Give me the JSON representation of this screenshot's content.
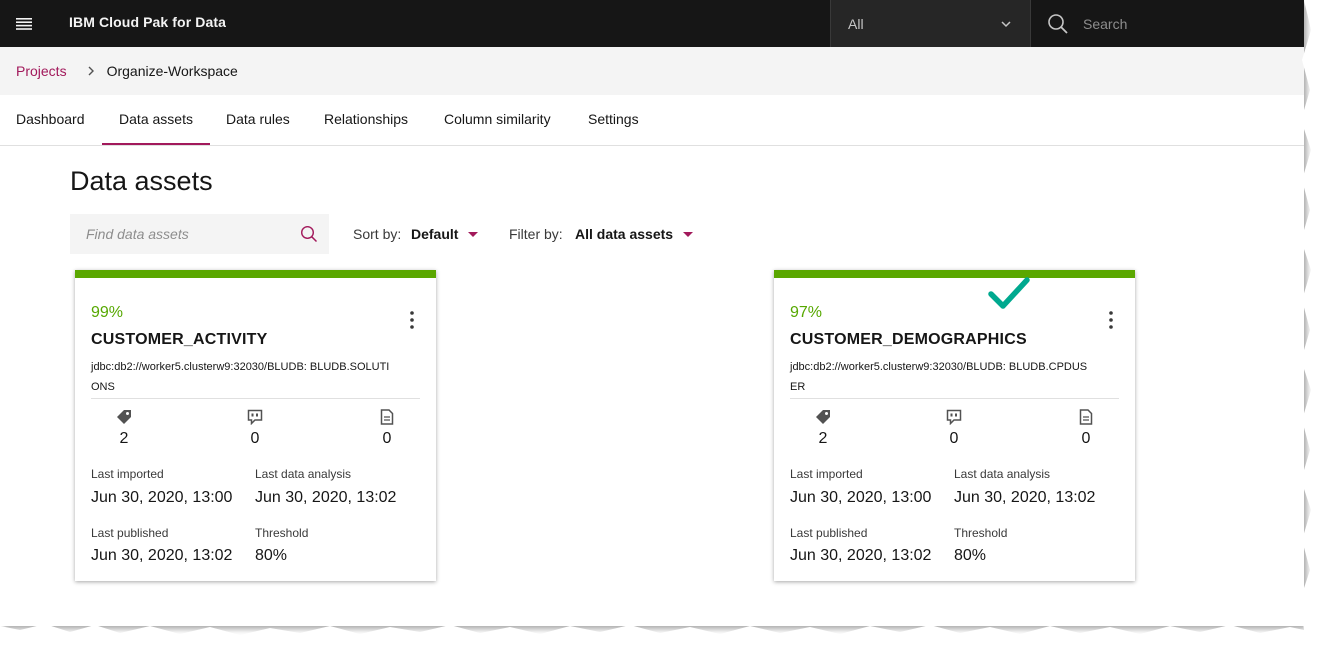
{
  "header": {
    "menu_icon": "hamburger-menu-icon",
    "brand": "IBM Cloud Pak for Data",
    "scope": {
      "selected": "All"
    },
    "search": {
      "placeholder": "Search"
    }
  },
  "breadcrumb": {
    "parent": "Projects",
    "current": "Organize-Workspace"
  },
  "tabs": [
    {
      "label": "Dashboard",
      "active": false
    },
    {
      "label": "Data assets",
      "active": true
    },
    {
      "label": "Data rules",
      "active": false
    },
    {
      "label": "Relationships",
      "active": false
    },
    {
      "label": "Column similarity",
      "active": false
    },
    {
      "label": "Settings",
      "active": false
    }
  ],
  "main": {
    "title": "Data assets",
    "find": {
      "placeholder": "Find data assets"
    },
    "sort": {
      "label": "Sort by:",
      "value": "Default"
    },
    "filter": {
      "label": "Filter by:",
      "value": "All data assets"
    }
  },
  "cards": [
    {
      "quality": "99%",
      "name": "CUSTOMER_ACTIVITY",
      "connection": "jdbc:db2://worker5.clusterw9:32030/BLUDB: BLUDB.SOLUTIONS",
      "stats": {
        "terms": "2",
        "comments": "0",
        "documents": "0"
      },
      "last_imported_label": "Last imported",
      "last_imported": "Jun 30, 2020, 13:00",
      "last_analysis_label": "Last data analysis",
      "last_analysis": "Jun 30, 2020, 13:02",
      "last_published_label": "Last published",
      "last_published": "Jun 30, 2020, 13:02",
      "threshold_label": "Threshold",
      "threshold": "80%"
    },
    {
      "quality": "97%",
      "name": "CUSTOMER_DEMOGRAPHICS",
      "connection": "jdbc:db2://worker5.clusterw9:32030/BLUDB: BLUDB.CPDUSER",
      "stats": {
        "terms": "2",
        "comments": "0",
        "documents": "0"
      },
      "last_imported_label": "Last imported",
      "last_imported": "Jun 30, 2020, 13:00",
      "last_analysis_label": "Last data analysis",
      "last_analysis": "Jun 30, 2020, 13:02",
      "last_published_label": "Last published",
      "last_published": "Jun 30, 2020, 13:02",
      "threshold_label": "Threshold",
      "threshold": "80%"
    }
  ],
  "colors": {
    "accent": "#a2195b",
    "quality_bar": "#5aa700",
    "annotation_check": "#00a98f",
    "header_bg": "#161616"
  },
  "icons": [
    "hamburger-menu-icon",
    "chevron-down-icon",
    "search-icon",
    "tag-icon",
    "comment-icon",
    "document-icon",
    "overflow-menu-icon",
    "checkmark-icon"
  ]
}
